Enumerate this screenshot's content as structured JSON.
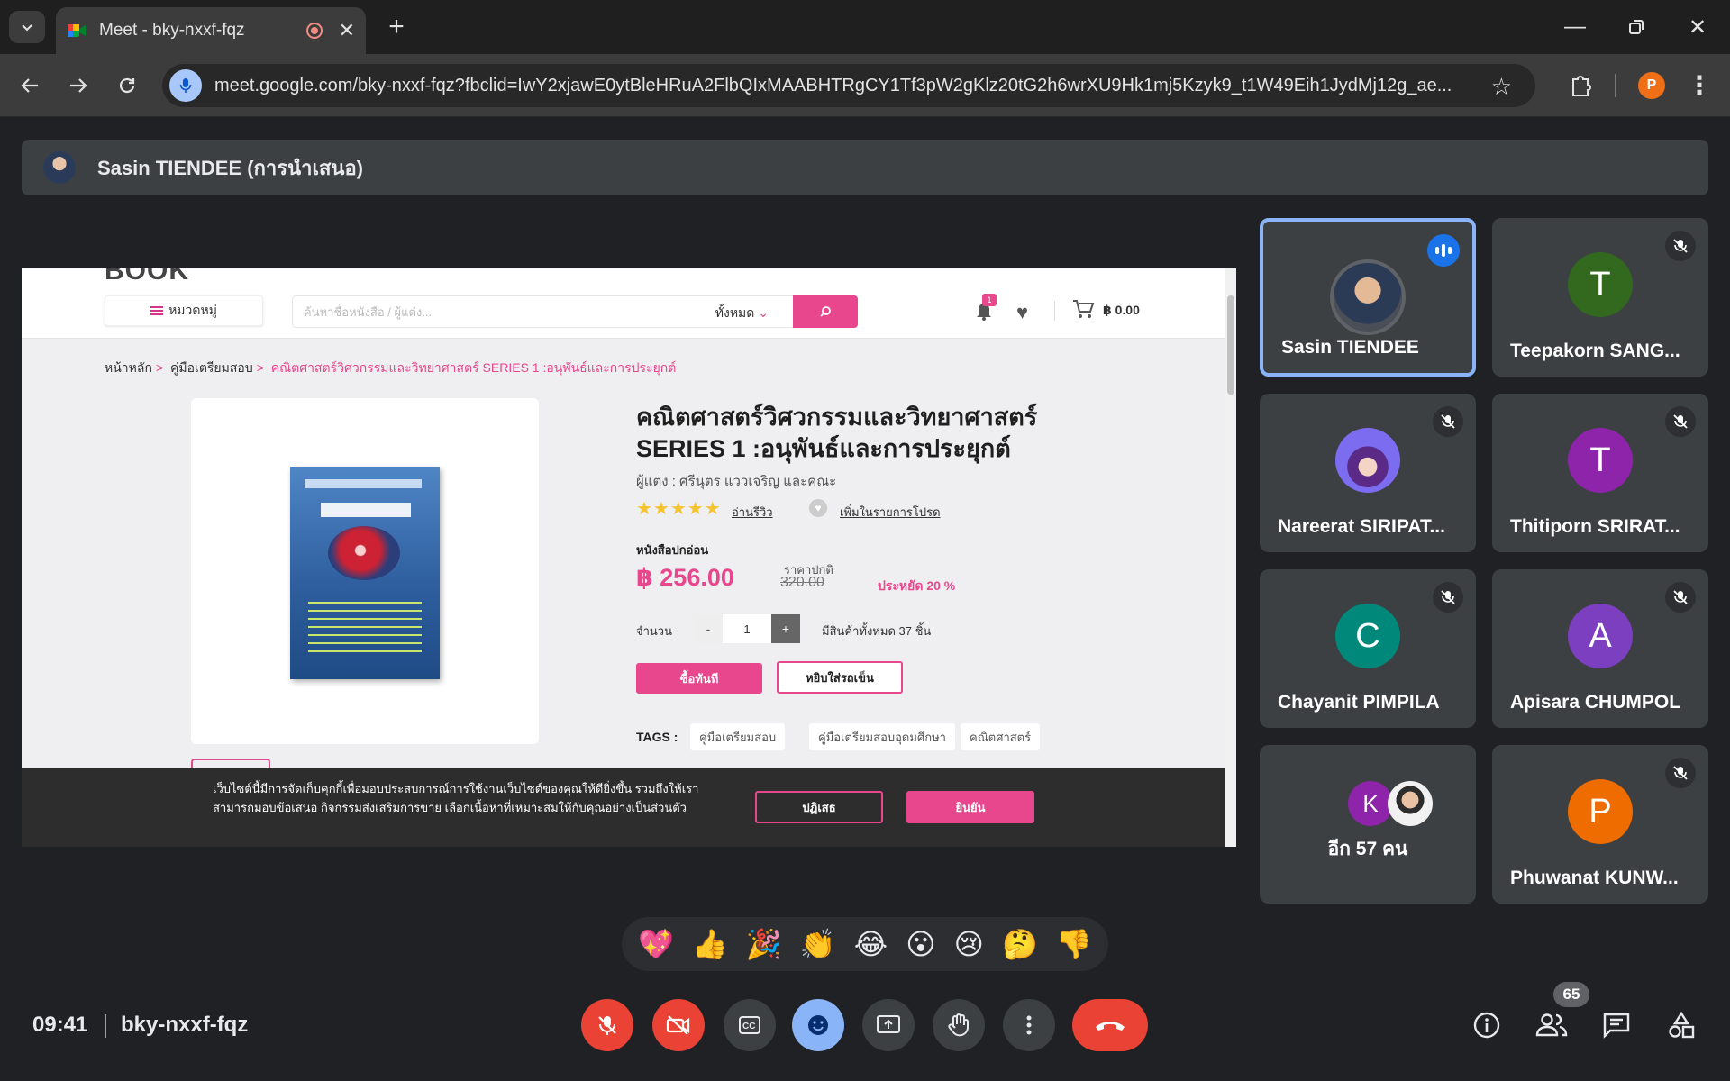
{
  "browser": {
    "tab_title": "Meet - bky-nxxf-fqz",
    "url": "meet.google.com/bky-nxxf-fqz?fbclid=IwY2xjawE0ytBleHRuA2FlbQIxMAABHTRgCY1Tf3pW2gKlz20tG2h6wrXU9Hk1mj5Kzyk9_t1W49Eih1JydMj12g_ae...",
    "profile_initial": "P"
  },
  "presenter_bar": {
    "label": "Sasin TIENDEE (การนำเสนอ)"
  },
  "shared_screen": {
    "logo_fragment": "BOOK",
    "category_button": "หมวดหมู่",
    "search_placeholder": "ค้นหาชื่อหนังสือ / ผู้แต่ง...",
    "search_scope": "ทั้งหมด",
    "notification_count": "1",
    "cart_total": "฿ 0.00",
    "breadcrumb": [
      "หน้าหลัก",
      "คู่มือเตรียมสอบ",
      "คณิตศาสตร์วิศวกรรมและวิทยาศาสตร์ SERIES 1 :อนุพันธ์และการประยุกต์"
    ],
    "product": {
      "title": "คณิตศาสตร์วิศวกรรมและวิทยาศาสตร์ SERIES 1 :อนุพันธ์และการประยุกต์",
      "author": "ผู้แต่ง : ศรีนุตร แววเจริญ และคณะ",
      "rating_stars": "★★★★★",
      "read_reviews": "อ่านรีวิว",
      "add_wishlist": "เพิ่มในรายการโปรด",
      "format": "หนังสือปกอ่อน",
      "price": "฿ 256.00",
      "regular_label": "ราคาปกติ",
      "regular_price": "320.00",
      "saving": "ประหยัด 20 %",
      "quantity_label": "จำนวน",
      "quantity_minus": "-",
      "quantity": "1",
      "quantity_plus": "+",
      "stock": "มีสินค้าทั้งหมด 37 ชิ้น",
      "buy_now": "ซื้อทันที",
      "add_to_cart": "หยิบใส่รถเข็น",
      "tags_label": "TAGS :",
      "tags": [
        "คู่มือเตรียมสอบ",
        "คู่มือเตรียมสอบอุดมศึกษา",
        "คณิตศาสตร์"
      ]
    },
    "cookie": {
      "text": "เว็บไซต์นี้มีการจัดเก็บคุกกี้เพื่อมอบประสบการณ์การใช้งานเว็บไซต์ของคุณให้ดียิ่งขึ้น รวมถึงให้เราสามารถมอบข้อเสนอ กิจกรรมส่งเสริมการขาย เลือกเนื้อหาที่เหมาะสมให้กับคุณอย่างเป็นส่วนตัว",
      "reject": "ปฏิเสธ",
      "accept": "ยินยัน"
    }
  },
  "participants": [
    {
      "name": "Sasin TIENDEE",
      "initial": "",
      "color": "",
      "speaking": true,
      "muted": false
    },
    {
      "name": "Teepakorn SANG...",
      "initial": "T",
      "color": "#33691e",
      "speaking": false,
      "muted": true
    },
    {
      "name": "Nareerat SIRIPAT...",
      "initial": "",
      "color": "#6b5bd6",
      "speaking": false,
      "muted": true
    },
    {
      "name": "Thitiporn SRIRAT...",
      "initial": "T",
      "color": "#8e24aa",
      "speaking": false,
      "muted": true
    },
    {
      "name": "Chayanit PIMPILA",
      "initial": "C",
      "color": "#00897b",
      "speaking": false,
      "muted": true
    },
    {
      "name": "Apisara CHUMPOL",
      "initial": "A",
      "color": "#7b3fbf",
      "speaking": false,
      "muted": true
    },
    {
      "name": "อีก 57 คน",
      "initial": "K",
      "color": "#8e24aa",
      "speaking": false,
      "muted": false
    },
    {
      "name": "Phuwanat KUNW...",
      "initial": "P",
      "color": "#ef6c00",
      "speaking": false,
      "muted": true
    }
  ],
  "reactions": [
    "💖",
    "👍",
    "🎉",
    "👏",
    "😂",
    "😮",
    "😢",
    "🤔",
    "👎"
  ],
  "meeting": {
    "time": "09:41",
    "code": "bky-nxxf-fqz",
    "participant_count": "65"
  }
}
